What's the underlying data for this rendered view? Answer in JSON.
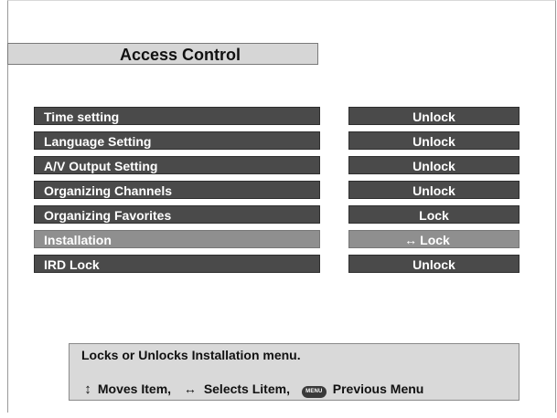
{
  "title": "Access Control",
  "menu": [
    {
      "label": "Time setting",
      "value": "Unlock",
      "selected": false
    },
    {
      "label": "Language Setting",
      "value": "Unlock",
      "selected": false
    },
    {
      "label": "A/V Output Setting",
      "value": "Unlock",
      "selected": false
    },
    {
      "label": "Organizing Channels",
      "value": "Unlock",
      "selected": false
    },
    {
      "label": "Organizing Favorites",
      "value": "Lock",
      "selected": false
    },
    {
      "label": "Installation",
      "value": "Lock",
      "selected": true
    },
    {
      "label": "IRD Lock",
      "value": "Unlock",
      "selected": false
    }
  ],
  "selection_arrow": "↔",
  "help": {
    "description": "Locks or Unlocks Installation menu.",
    "move_icon": "↕",
    "move_label": "Moves Item,",
    "select_icon": "↔",
    "select_label": "Selects Litem,",
    "menu_button_text": "MENU",
    "previous_label": "Previous Menu"
  },
  "colors": {
    "row_bg": "#4a4a4a",
    "row_selected_bg": "#8f8f8f",
    "title_bg": "#d6d6d6",
    "help_bg": "#d9d9d9"
  }
}
